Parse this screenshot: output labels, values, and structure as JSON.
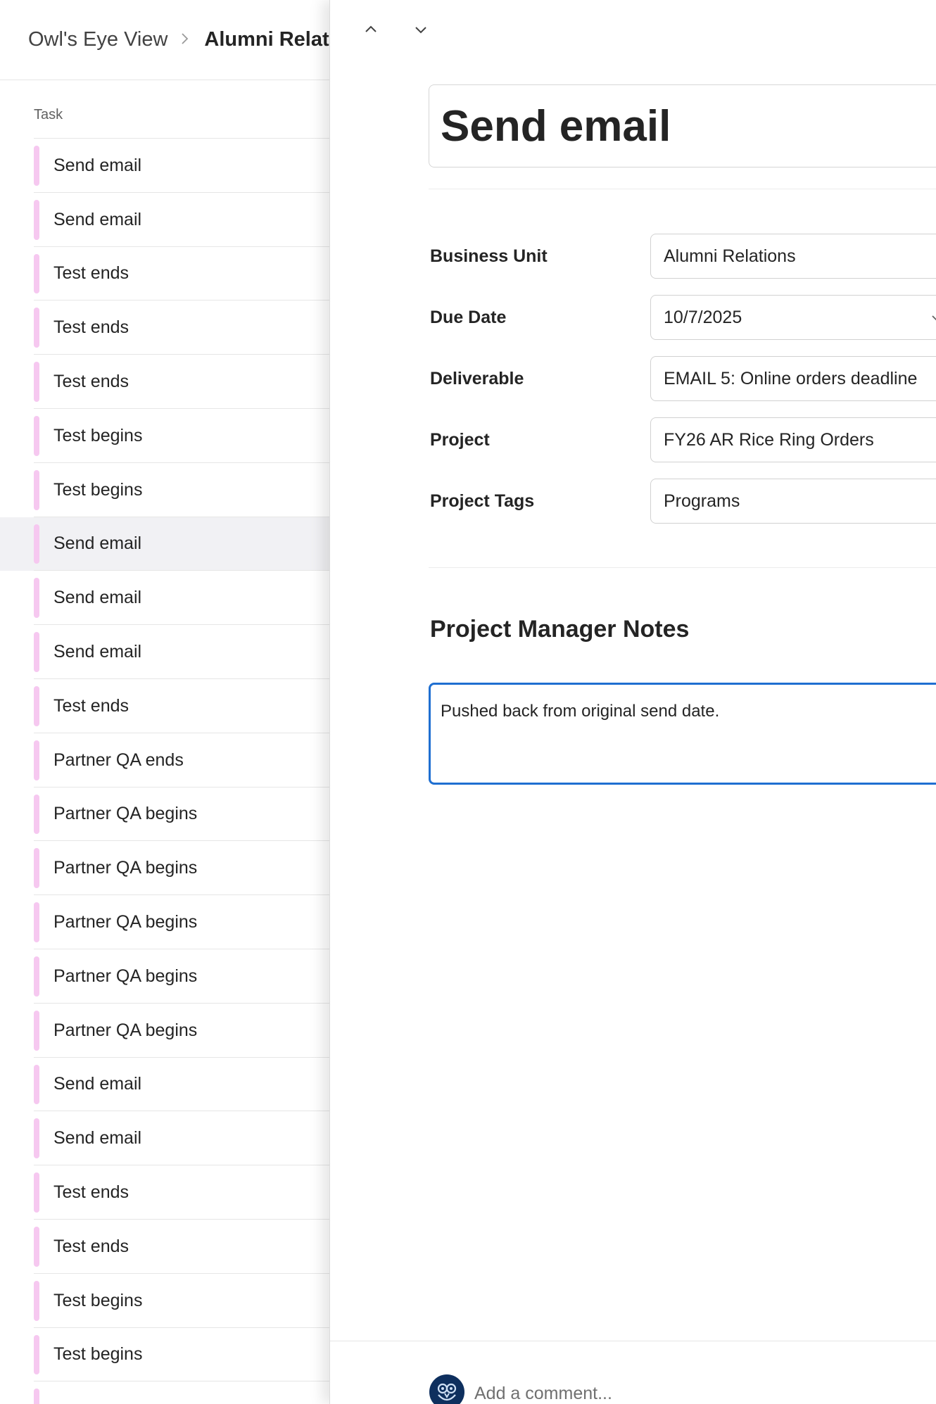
{
  "breadcrumb": {
    "root": "Owl's Eye View",
    "separator_icon": "chevron-right-icon",
    "current": "Alumni Relat"
  },
  "list": {
    "header": "Task",
    "accent_color": "#f6c8f0",
    "selected_index": 7,
    "items": [
      {
        "label": "Send email"
      },
      {
        "label": "Send email"
      },
      {
        "label": "Test ends"
      },
      {
        "label": "Test ends"
      },
      {
        "label": "Test ends"
      },
      {
        "label": "Test begins"
      },
      {
        "label": "Test begins"
      },
      {
        "label": "Send email"
      },
      {
        "label": "Send email"
      },
      {
        "label": "Send email"
      },
      {
        "label": "Test ends"
      },
      {
        "label": "Partner QA ends"
      },
      {
        "label": "Partner QA begins"
      },
      {
        "label": "Partner QA begins"
      },
      {
        "label": "Partner QA begins"
      },
      {
        "label": "Partner QA begins"
      },
      {
        "label": "Partner QA begins"
      },
      {
        "label": "Send email"
      },
      {
        "label": "Send email"
      },
      {
        "label": "Test ends"
      },
      {
        "label": "Test ends"
      },
      {
        "label": "Test begins"
      },
      {
        "label": "Test begins"
      },
      {
        "label": ""
      }
    ]
  },
  "detail": {
    "nav": {
      "up_icon": "chevron-up-icon",
      "down_icon": "chevron-down-icon"
    },
    "title": "Send email",
    "fields": {
      "business_unit": {
        "label": "Business Unit",
        "value": "Alumni Relations"
      },
      "due_date": {
        "label": "Due Date",
        "value": "10/7/2025"
      },
      "deliverable": {
        "label": "Deliverable",
        "value": "EMAIL 5: Online orders deadline"
      },
      "project": {
        "label": "Project",
        "value": "FY26 AR Rice Ring Orders"
      },
      "project_tags": {
        "label": "Project Tags",
        "value": "Programs"
      }
    },
    "notes": {
      "title": "Project Manager Notes",
      "value": "Pushed back from original send date."
    },
    "comment": {
      "placeholder": "Add a comment...",
      "avatar_icon": "owl-logo-icon"
    },
    "accent_color": "#1f6fd1"
  }
}
